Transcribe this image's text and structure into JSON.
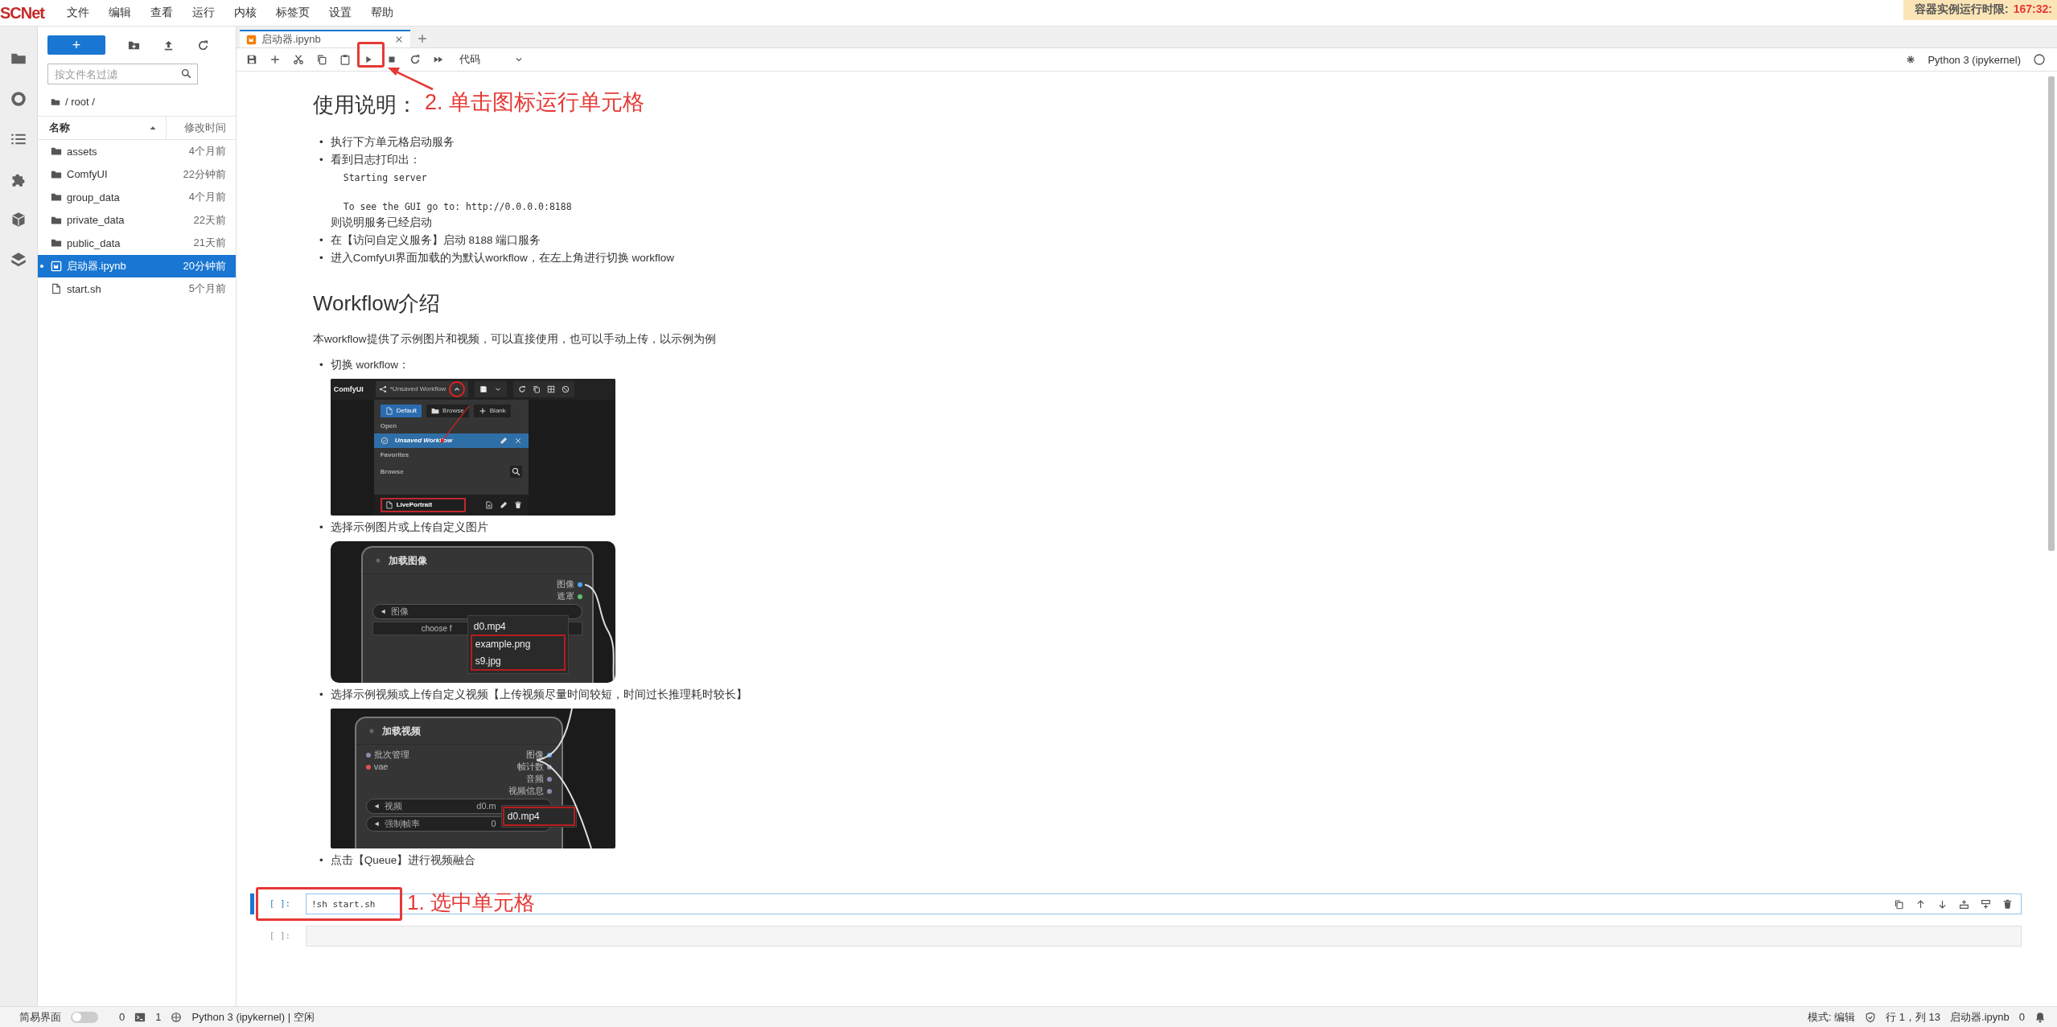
{
  "menu_bar": {
    "logo": "SCNet",
    "items": [
      "文件",
      "编辑",
      "查看",
      "运行",
      "内核",
      "标签页",
      "设置",
      "帮助"
    ]
  },
  "runtime_banner": {
    "label": "容器实例运行时限:",
    "value": "167:32:"
  },
  "file_browser": {
    "new_button": "+",
    "filter_placeholder": "按文件名过滤",
    "path": "/ root /",
    "columns": [
      "名称",
      "修改时间"
    ],
    "rows": [
      {
        "kind": "folder",
        "name": "assets",
        "modified": "4个月前",
        "selected": false,
        "running": false
      },
      {
        "kind": "folder",
        "name": "ComfyUI",
        "modified": "22分钟前",
        "selected": false,
        "running": false
      },
      {
        "kind": "folder",
        "name": "group_data",
        "modified": "4个月前",
        "selected": false,
        "running": false
      },
      {
        "kind": "folder",
        "name": "private_data",
        "modified": "22天前",
        "selected": false,
        "running": false
      },
      {
        "kind": "folder",
        "name": "public_data",
        "modified": "21天前",
        "selected": false,
        "running": false
      },
      {
        "kind": "notebook",
        "name": "启动器.ipynb",
        "modified": "20分钟前",
        "selected": true,
        "running": true
      },
      {
        "kind": "file",
        "name": "start.sh",
        "modified": "5个月前",
        "selected": false,
        "running": false
      }
    ]
  },
  "notebook": {
    "tabs": [
      {
        "title": "启动器.ipynb",
        "selected": true
      }
    ],
    "cell_type": "代码",
    "kernel": "Python 3 (ipykernel)",
    "blocks": [
      {
        "kind": "heading",
        "text": "使用说明："
      },
      {
        "kind": "list",
        "marker": "•",
        "items": [
          {
            "text": "执行下方单元格启动服务"
          },
          {
            "text": "看到日志打印出：",
            "code": "Starting server\n\nTo see the GUI go to: http://0.0.0.0:8188",
            "after": "则说明服务已经启动"
          },
          {
            "text": "在【访问自定义服务】启动 8188 端口服务"
          },
          {
            "text": "进入ComfyUI界面加载的为默认workflow，在左上角进行切换 workflow"
          }
        ]
      },
      {
        "kind": "heading",
        "text": "Workflow介绍"
      },
      {
        "kind": "paragraph",
        "text": "本workflow提供了示例图片和视频，可以直接使用，也可以手动上传，以示例为例"
      },
      {
        "kind": "list",
        "marker": "•",
        "items": [
          {
            "text": "切换 workflow：",
            "figure": {
              "kind": "workflow-menu",
              "app": "ComfyUI",
              "workflow": "*Unsaved Workflow",
              "buttons": [
                {
                  "label": "Default",
                  "selected": true
                },
                {
                  "label": "Browse",
                  "selected": false
                },
                {
                  "label": "Blank",
                  "selected": false
                }
              ],
              "sections": [
                {
                  "kind": "open",
                  "title": "Open",
                  "items": [
                    {
                      "label": "Unsaved Workflow",
                      "selected": true,
                      "highlighted": false
                    }
                  ]
                },
                {
                  "kind": "favorites",
                  "title": "Favorites"
                },
                {
                  "kind": "browse",
                  "title": "Browse",
                  "items": [
                    {
                      "label": "LivePortrait",
                      "selected": false,
                      "highlighted": true
                    }
                  ]
                }
              ]
            }
          },
          {
            "text": "选择示例图片或上传自定义图片",
            "figure": {
              "kind": "load-image",
              "title": "加载图像",
              "outputs": [
                {
                  "label": "图像",
                  "color": "#4da3f0"
                },
                {
                  "label": "遮罩",
                  "color": "#57c46b"
                }
              ],
              "widgets": [
                {
                  "label": "图像"
                }
              ],
              "upload_button": "choose f",
              "options": [
                {
                  "label": "d0.mp4",
                  "highlighted": false
                },
                {
                  "label": "example.png",
                  "highlighted": true
                },
                {
                  "label": "s9.jpg",
                  "highlighted": true
                }
              ]
            }
          },
          {
            "text": "选择示例视频或上传自定义视频【上传视频尽量时间较短，时间过长推理耗时较长】",
            "figure": {
              "kind": "load-video",
              "title": "加载视频",
              "inputs": [
                {
                  "label": "批次管理",
                  "color": "#8c8cb0"
                },
                {
                  "label": "vae",
                  "color": "#e55050"
                }
              ],
              "outputs": [
                {
                  "label": "图像",
                  "color": "#4da3f0"
                },
                {
                  "label": "帧计数",
                  "color": "#8c8cb0"
                },
                {
                  "label": "音频",
                  "color": "#8c8cb0"
                },
                {
                  "label": "视频信息",
                  "color": "#8c8cb0"
                }
              ],
              "widgets": [
                {
                  "label": "视频",
                  "value": "d0.m"
                },
                {
                  "label": "强制帧率",
                  "value": "0"
                }
              ],
              "options": [
                {
                  "label": "d0.mp4",
                  "highlighted": true
                }
              ]
            }
          },
          {
            "text": "点击【Queue】进行视频融合"
          }
        ]
      }
    ],
    "cells": [
      {
        "prompt": "[ ]:",
        "code": "!sh start.sh",
        "selected": true
      },
      {
        "prompt": "[ ]:",
        "selected": false
      }
    ]
  },
  "annotations": [
    {
      "kind": "toolbar",
      "text": "2. 单击图标运行单元格"
    },
    {
      "kind": "cell",
      "text": "1. 选中单元格"
    }
  ],
  "status_bar": {
    "simple_mode": {
      "label": "简易界面",
      "on": false
    },
    "terminals": "0",
    "kernels": "1",
    "kernel": "Python 3 (ipykernel) | 空闲",
    "mode": "模式: 编辑",
    "position": "行 1，列 13",
    "file": "启动器.ipynb",
    "notifications": "0"
  }
}
